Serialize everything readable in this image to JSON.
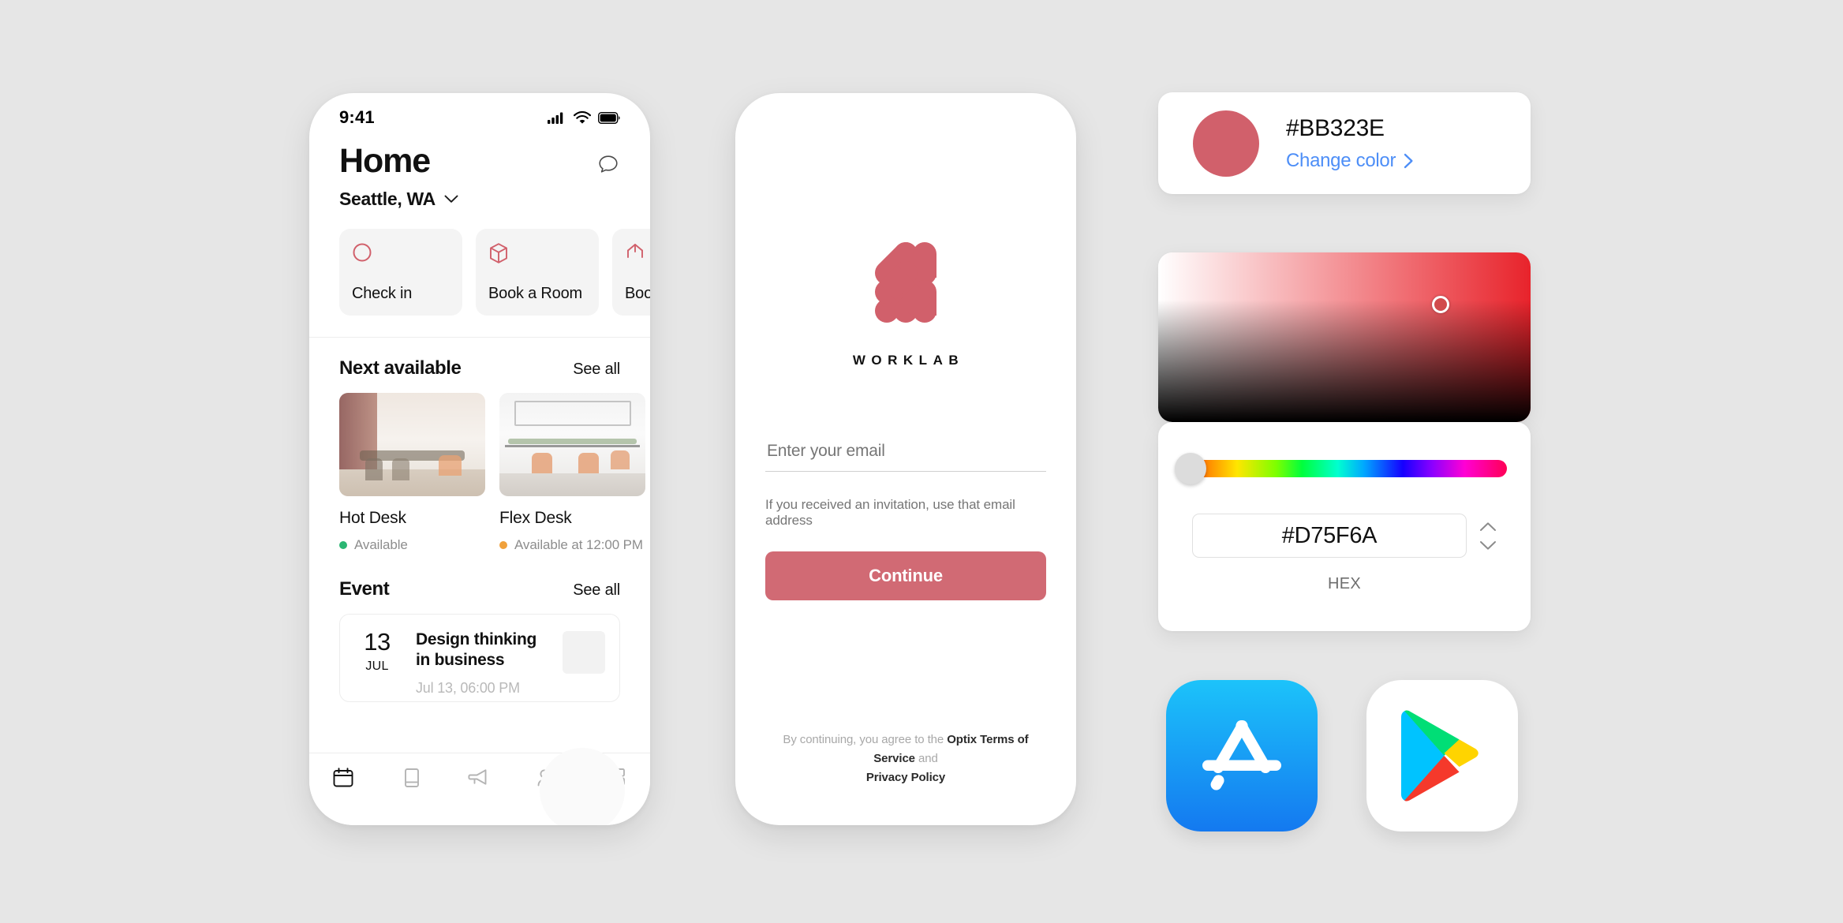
{
  "canvas": {
    "background": "#e6e6e6"
  },
  "home_phone": {
    "status": {
      "time": "9:41",
      "cellular_icon": "signal-bars-icon",
      "wifi_icon": "wifi-icon",
      "battery_icon": "battery-icon"
    },
    "title": "Home",
    "chat_icon": "chat-bubble-icon",
    "location": "Seattle, WA",
    "location_chevron_icon": "chevron-down-icon",
    "quick_actions": [
      {
        "label": "Check in",
        "icon": "circle-icon"
      },
      {
        "label": "Book a Room",
        "icon": "cube-icon"
      },
      {
        "label": "Book a Desk",
        "icon": "desk-icon"
      }
    ],
    "next_available": {
      "title": "Next available",
      "see_all": "See all",
      "items": [
        {
          "name": "Hot Desk",
          "status": "Available",
          "status_color": "#2bb673"
        },
        {
          "name": "Flex Desk",
          "status": "Available at 12:00 PM",
          "status_color": "#f0a13c"
        }
      ]
    },
    "event_section": {
      "title": "Event",
      "see_all": "See all",
      "event": {
        "day": "13",
        "month": "JUL",
        "title": "Design thinking in business",
        "datetime": "Jul 13, 06:00 PM"
      }
    },
    "tabs": [
      {
        "icon": "calendar-icon",
        "active": true
      },
      {
        "icon": "book-icon",
        "active": false
      },
      {
        "icon": "megaphone-icon",
        "active": false
      },
      {
        "icon": "people-icon",
        "active": false
      },
      {
        "icon": "grid-icon",
        "active": false
      }
    ]
  },
  "login_phone": {
    "logo_icon": "worklab-logo-icon",
    "brand": "WORKLAB",
    "email_placeholder": "Enter your email",
    "email_value": "",
    "hint": "If you received an invitation, use that email address",
    "continue_label": "Continue",
    "continue_color": "#d16a74",
    "legal_prefix": "By continuing, you agree to the ",
    "legal_brand": "Optix",
    "legal_tos": "Terms of Service",
    "legal_and": " and ",
    "legal_privacy": "Privacy Policy"
  },
  "color_panel": {
    "swatch": {
      "hex": "#BB323E",
      "swatch_color": "#d1606b",
      "change_label": "Change color",
      "chevron_icon": "chevron-right-icon",
      "link_color": "#4d8ef7"
    },
    "picker": {
      "handle_color": "#d14a4c",
      "base_hue": "#e8232b"
    },
    "hex_input": {
      "value": "#D75F6A",
      "label": "HEX",
      "stepper_up_icon": "chevron-up-icon",
      "stepper_down_icon": "chevron-down-icon"
    }
  },
  "store_badges": [
    {
      "name": "app-store-icon",
      "label": "App Store"
    },
    {
      "name": "google-play-icon",
      "label": "Google Play"
    }
  ]
}
